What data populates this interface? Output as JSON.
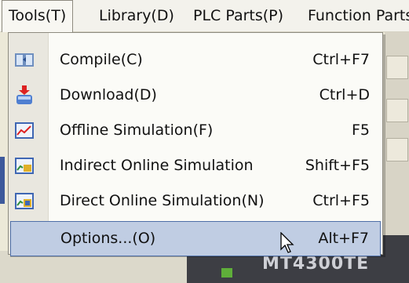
{
  "menubar": {
    "items": [
      {
        "label": "Tools(T)",
        "open": true
      },
      {
        "label": "Library(D)"
      },
      {
        "label": "PLC Parts(P)"
      },
      {
        "label": "Function Parts"
      }
    ]
  },
  "menu": {
    "items": [
      {
        "label": "Compile(C)",
        "shortcut": "Ctrl+F7",
        "icon": "compile-icon"
      },
      {
        "label": "Download(D)",
        "shortcut": "Ctrl+D",
        "icon": "download-icon"
      },
      {
        "label": "Offline Simulation(F)",
        "shortcut": "F5",
        "icon": "offline-simulation-icon"
      },
      {
        "label": "Indirect Online Simulation",
        "shortcut": "Shift+F5",
        "icon": "indirect-simulation-icon"
      },
      {
        "label": "Direct Online Simulation(N)",
        "shortcut": "Ctrl+F5",
        "icon": "direct-simulation-icon"
      },
      {
        "label": "Options...(O)",
        "shortcut": "Alt+F7",
        "selected": true
      }
    ]
  },
  "background": {
    "device_label": "MT4300TE"
  },
  "colors": {
    "menu_bg": "#fbfbf7",
    "gutter": "#e9e7df",
    "highlight": "#c0cde3",
    "highlight_border": "#4f6fa8"
  }
}
